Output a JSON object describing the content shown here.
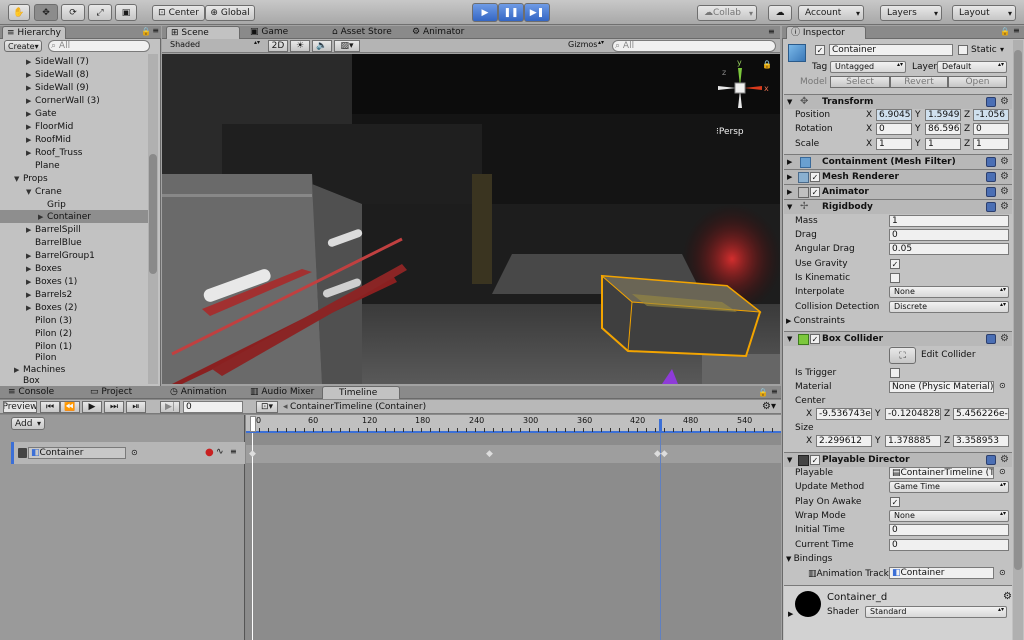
{
  "toolbar": {
    "center": "Center",
    "global": "Global",
    "collab": "Collab",
    "account": "Account",
    "layers": "Layers",
    "layout": "Layout"
  },
  "hierarchy": {
    "tab": "Hierarchy",
    "create": "Create",
    "search_placeholder": "All",
    "items": [
      "SideWall (7)",
      "SideWall (8)",
      "SideWall (9)",
      "CornerWall (3)",
      "Gate",
      "FloorMid",
      "RoofMid",
      "Roof_Truss",
      "Plane",
      "Props",
      "Crane",
      "Grip",
      "Container",
      "BarrelSpill",
      "BarrelBlue",
      "BarrelGroup1",
      "Boxes",
      "Boxes (1)",
      "Barrels2",
      "Boxes (2)",
      "Pilon (3)",
      "Pilon (2)",
      "Pilon (1)",
      "Pilon",
      "Machines",
      "Box"
    ]
  },
  "scene": {
    "tabs": [
      "Scene",
      "Game",
      "Asset Store",
      "Animator"
    ],
    "shaded": "Shaded",
    "mode_2d": "2D",
    "gizmos": "Gizmos",
    "search_placeholder": "All",
    "persp": "Persp",
    "axis_y": "y",
    "axis_x": "x",
    "axis_z": "z"
  },
  "bottom": {
    "tabs": [
      "Console",
      "Project",
      "Animation",
      "Audio Mixer",
      "Timeline"
    ],
    "preview": "Preview",
    "frame": "0",
    "asset": "ContainerTimeline (Container)",
    "add": "Add",
    "track": "Container",
    "ruler": [
      "0",
      "60",
      "120",
      "180",
      "240",
      "300",
      "360",
      "420",
      "480",
      "540"
    ]
  },
  "inspector": {
    "tab": "Inspector",
    "name": "Container",
    "static": "Static",
    "tag_label": "Tag",
    "tag": "Untagged",
    "layer_label": "Layer",
    "layer": "Default",
    "model": "Model",
    "select": "Select",
    "revert": "Revert",
    "open": "Open",
    "transform": {
      "title": "Transform",
      "position": "Position",
      "rotation": "Rotation",
      "scale": "Scale",
      "pos": [
        "6.9045",
        "1.5949",
        "-1.056"
      ],
      "rot": [
        "0",
        "86.596",
        "0"
      ],
      "scl": [
        "1",
        "1",
        "1"
      ],
      "x": "X",
      "y": "Y",
      "z": "Z"
    },
    "mesh_filter": "Containment (Mesh Filter)",
    "mesh_renderer": "Mesh Renderer",
    "animator": "Animator",
    "rigidbody": {
      "title": "Rigidbody",
      "mass": "Mass",
      "mass_v": "1",
      "drag": "Drag",
      "drag_v": "0",
      "angular": "Angular Drag",
      "angular_v": "0.05",
      "gravity": "Use Gravity",
      "kinematic": "Is Kinematic",
      "interpolate": "Interpolate",
      "interpolate_v": "None",
      "collision": "Collision Detection",
      "collision_v": "Discrete",
      "constraints": "Constraints"
    },
    "box_collider": {
      "title": "Box Collider",
      "edit": "Edit Collider",
      "trigger": "Is Trigger",
      "material": "Material",
      "material_v": "None (Physic Material)",
      "center": "Center",
      "center_v": [
        "-9.536743e",
        "-0.1204828",
        "5.456226e-"
      ],
      "size": "Size",
      "size_v": [
        "2.299612",
        "1.378885",
        "3.358953"
      ]
    },
    "director": {
      "title": "Playable Director",
      "playable": "Playable",
      "playable_v": "ContainerTimeline (T",
      "update": "Update Method",
      "update_v": "Game Time",
      "awake": "Play On Awake",
      "wrap": "Wrap Mode",
      "wrap_v": "None",
      "initial": "Initial Time",
      "initial_v": "0",
      "current": "Current Time",
      "current_v": "0",
      "bindings": "Bindings",
      "anim_track": "Animation Track",
      "anim_track_v": "Container"
    },
    "material": {
      "name": "Container_d",
      "shader": "Shader",
      "shader_v": "Standard"
    }
  },
  "colors": {
    "accent": "#3b6fd6",
    "selection": "#ffb000",
    "panel": "#c2c2c2"
  }
}
